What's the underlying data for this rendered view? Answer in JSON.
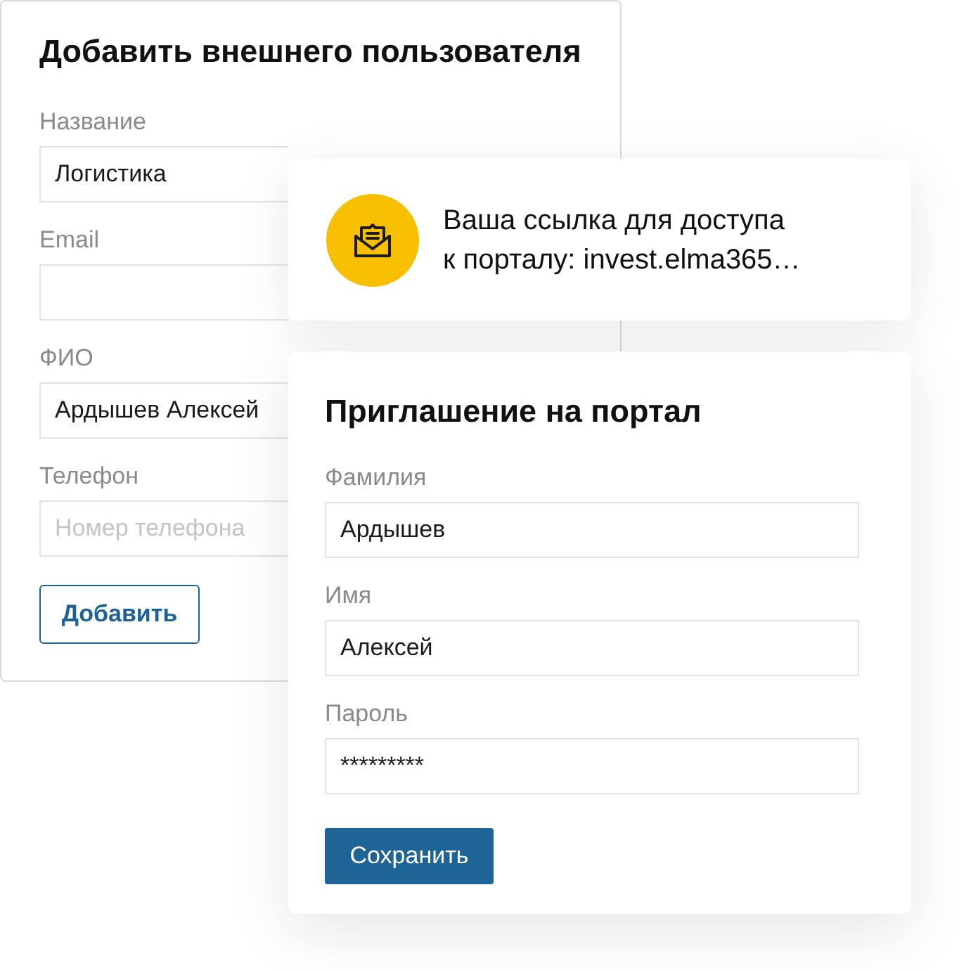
{
  "add_user_form": {
    "title": "Добавить внешнего пользователя",
    "fields": [
      {
        "label": "Название",
        "value": "Логистика"
      },
      {
        "label": "Email"
      },
      {
        "label": "ФИО",
        "value": "Ардышев Алексей"
      },
      {
        "label": "Телефон",
        "placeholder": "Номер телефона"
      }
    ],
    "button": "Добавить"
  },
  "notification": {
    "lines": [
      "Ваша ссылка для доступа",
      "к порталу: invest.elma365…"
    ]
  },
  "invite_form": {
    "title": "Приглашение на портал",
    "fields": [
      {
        "label": "Фамилия",
        "value": "Ардышев"
      },
      {
        "label": "Имя",
        "value": "Алексей"
      },
      {
        "label": "Пароль",
        "value": "*********"
      }
    ],
    "button": "Сохранить"
  }
}
